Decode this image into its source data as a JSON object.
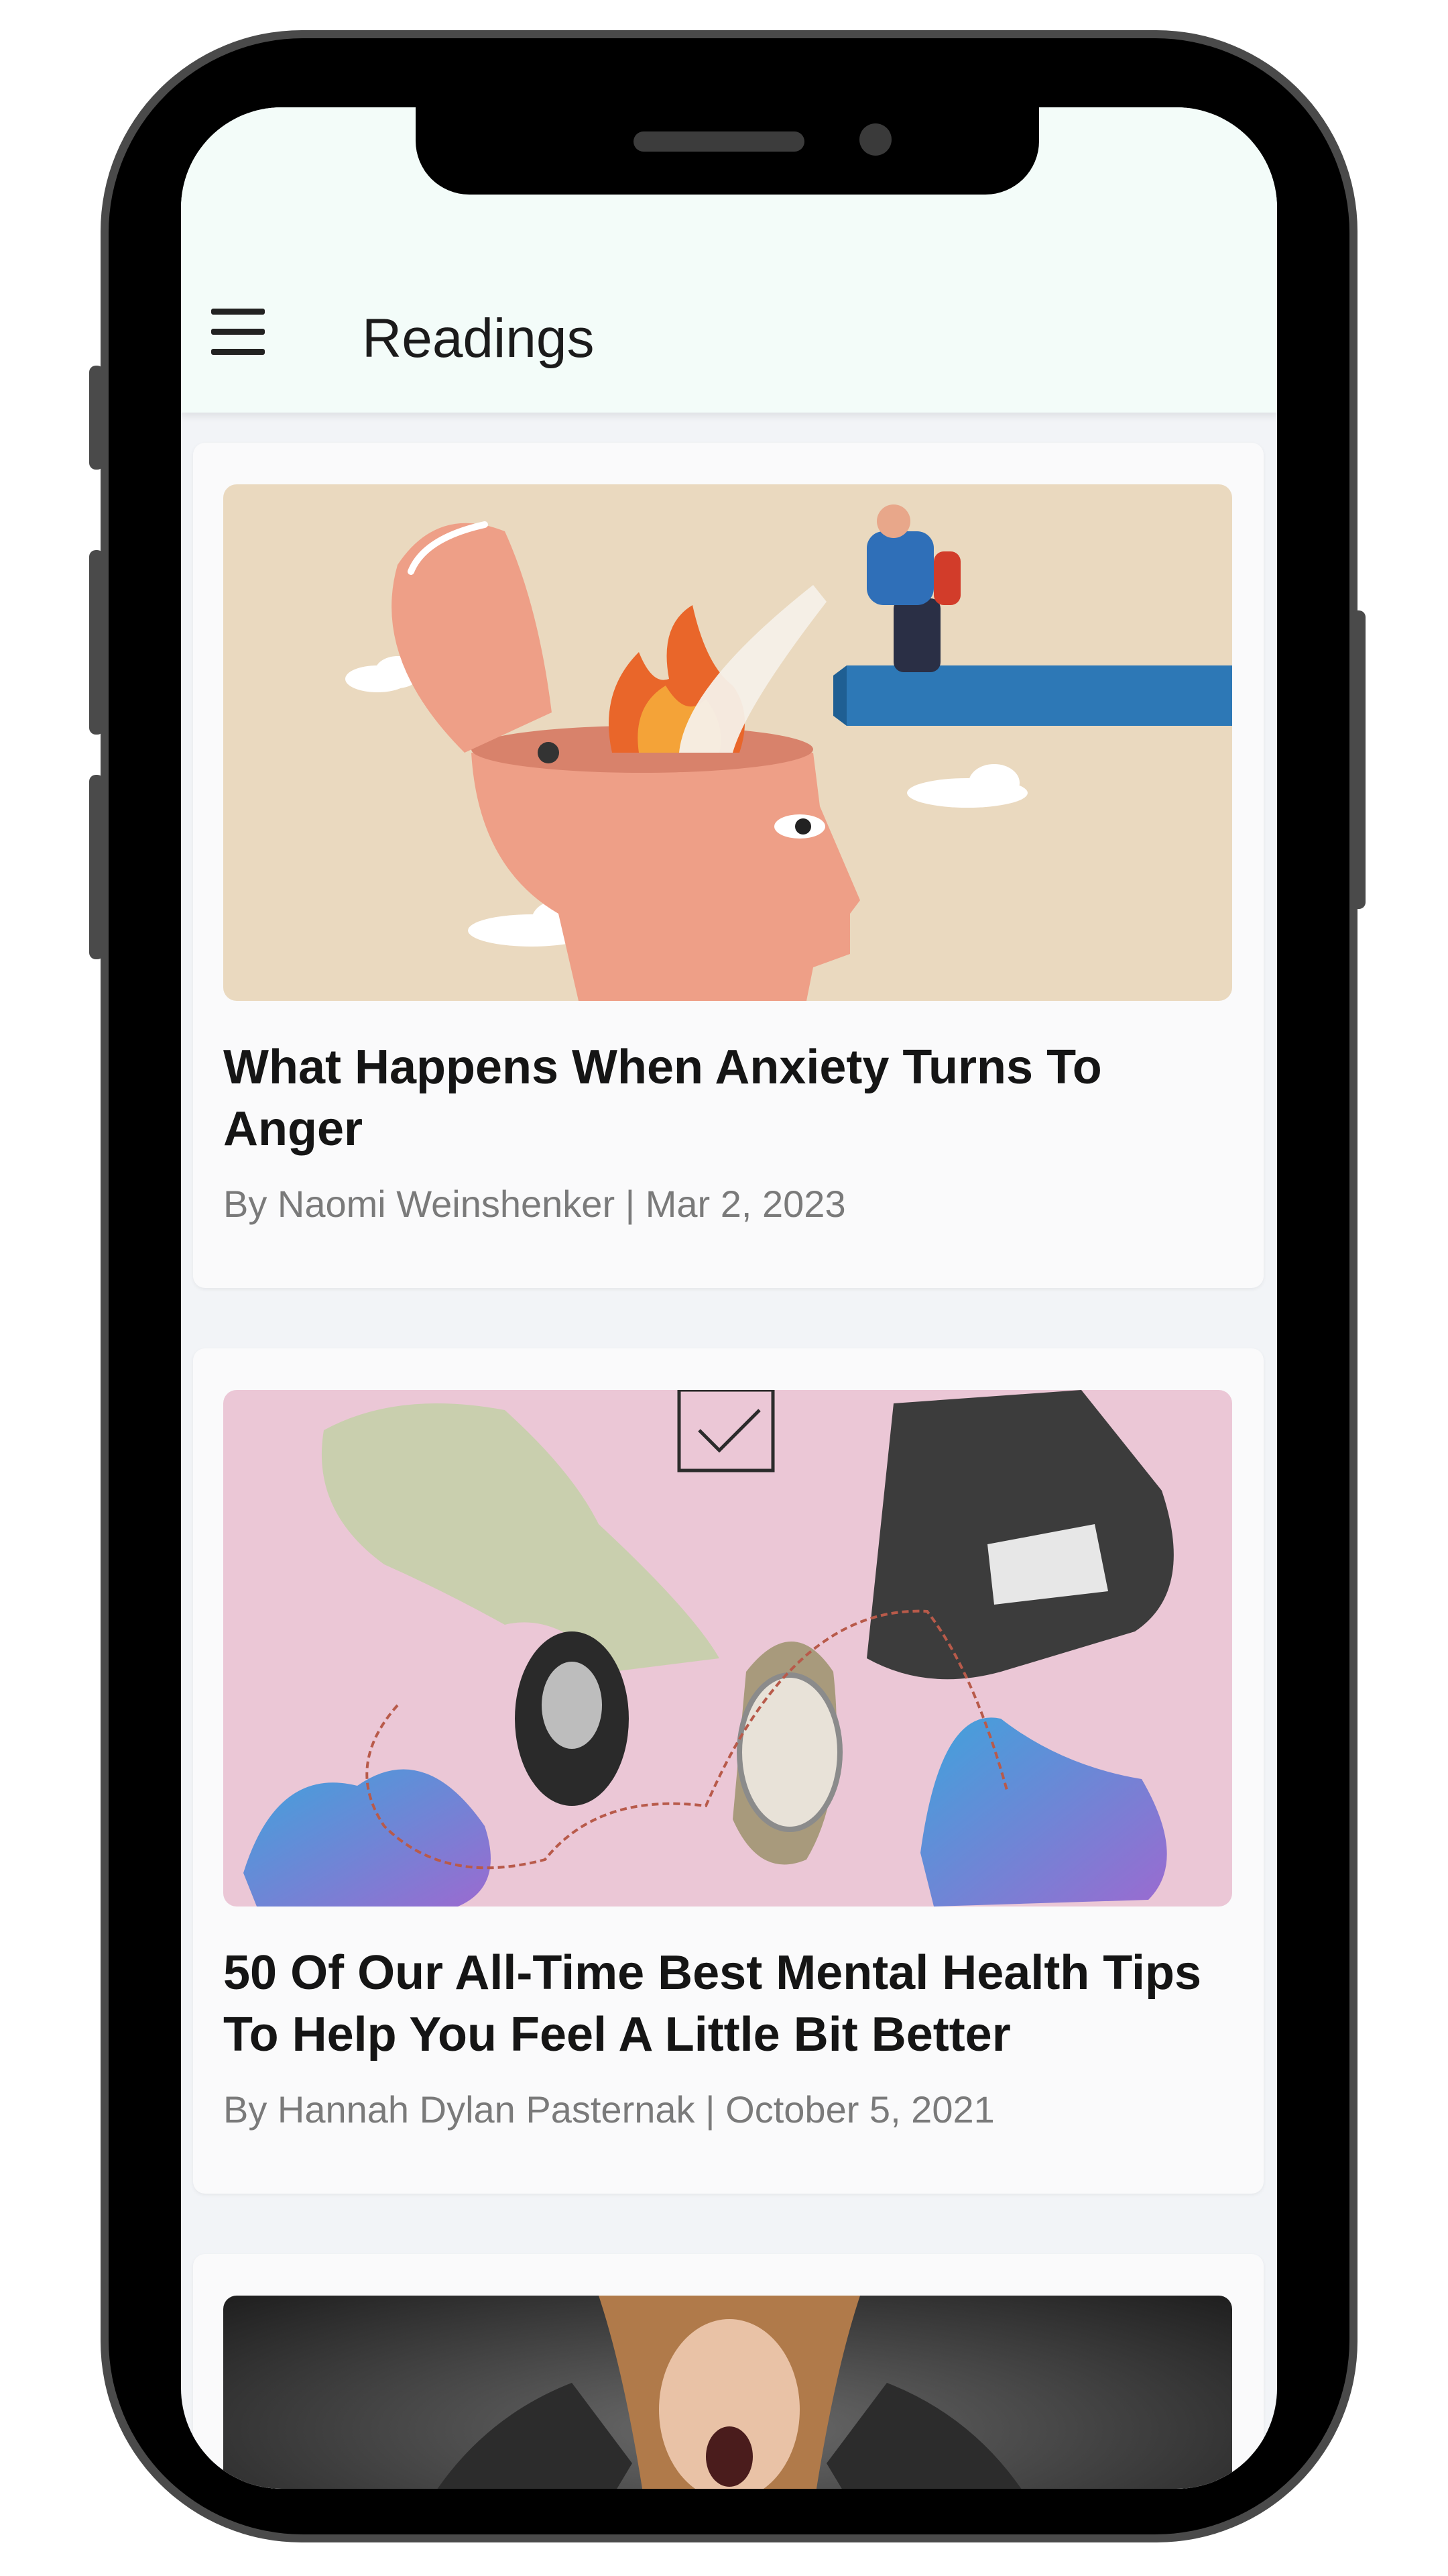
{
  "app": {
    "title": "Readings"
  },
  "articles": [
    {
      "title": "What Happens When Anxiety Turns To Anger",
      "meta": "By Naomi Weinshenker | Mar 2, 2023",
      "image": "illustration-head-fire-extinguisher"
    },
    {
      "title": "50 Of Our All-Time Best Mental Health Tips To Help You Feel A Little Bit Better",
      "meta": "By Hannah Dylan Pasternak | October 5, 2021",
      "image": "collage-illustration-pink"
    },
    {
      "title": "",
      "meta": "",
      "image": "photo-screaming-woman"
    }
  ],
  "colors": {
    "appbar": "#f3fcf9",
    "screen": "#f2f4f7",
    "card1_bg": "#ead9bf",
    "card2_bg": "#ebc7d6",
    "card3_bg": "#2a2a2a"
  }
}
